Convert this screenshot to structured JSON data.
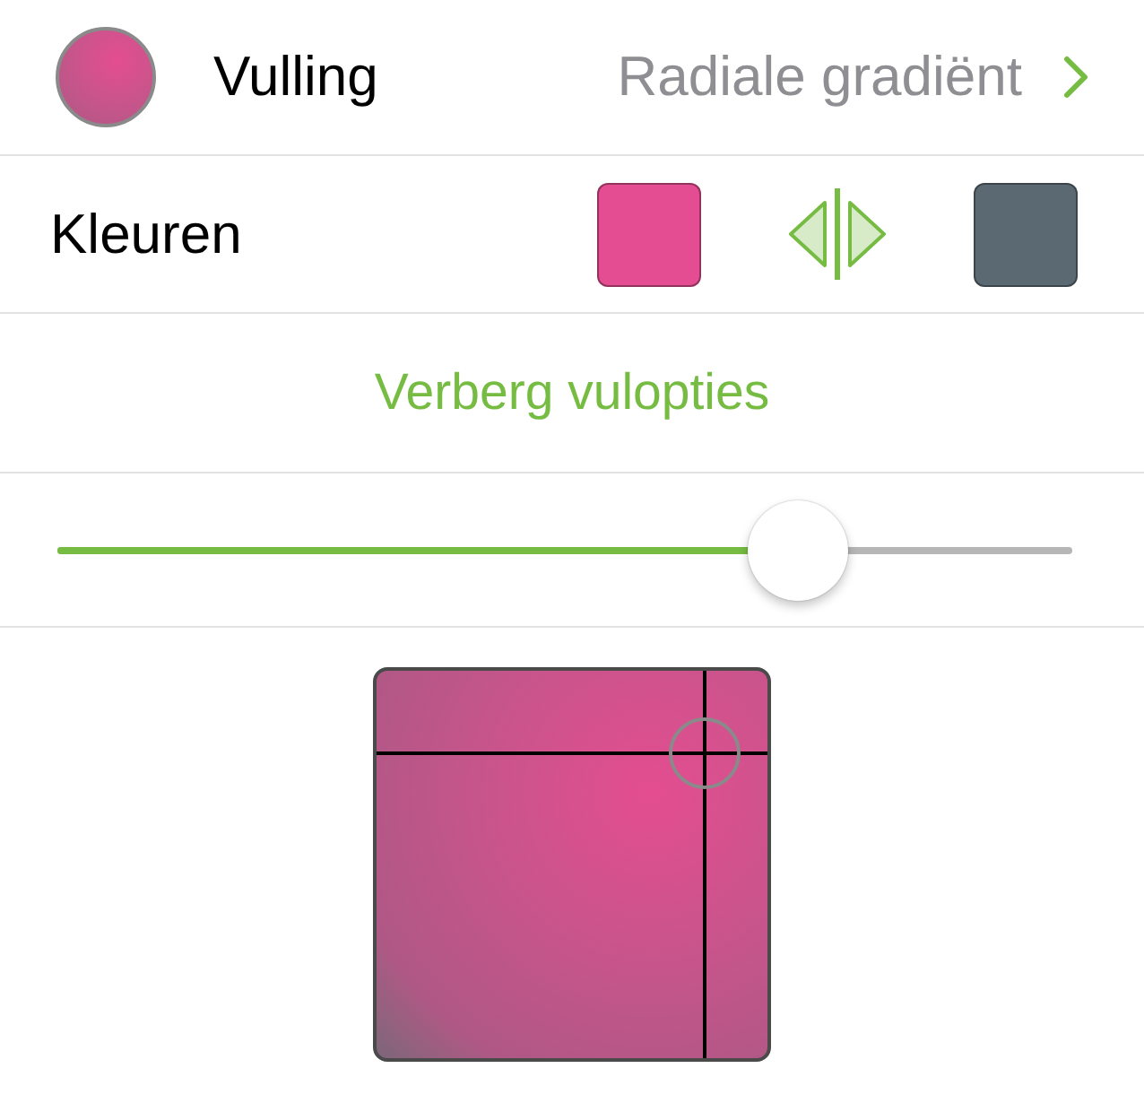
{
  "fill": {
    "label": "Vulling",
    "value": "Radiale gradiënt"
  },
  "colors": {
    "label": "Kleuren",
    "swatches": [
      {
        "color": "#e44d91"
      },
      {
        "color": "#5b6a72"
      }
    ]
  },
  "options_toggle": {
    "label": "Verberg vulopties"
  },
  "slider": {
    "level": 0.73
  }
}
